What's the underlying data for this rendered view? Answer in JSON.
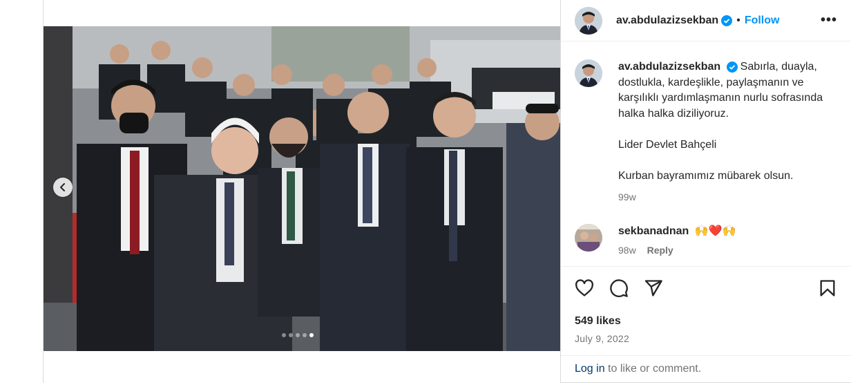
{
  "post": {
    "username": "av.abdulazizsekban",
    "verified_icon": "verified-badge-icon",
    "separator": "•",
    "follow_label": "Follow",
    "more_label": "•••",
    "caption": "Sabırla, duayla, dostlukla, kardeşlikle, paylaşmanın ve karşılıklı yardımlaşmanın nurlu sofrasında halka halka diziliyoruz.\n\nLider Devlet Bahçeli\n\nKurban bayramımız mübarek olsun.",
    "caption_time": "99w"
  },
  "comment": {
    "username": "sekbanadnan",
    "text": "🙌❤️🙌",
    "time": "98w",
    "reply_label": "Reply"
  },
  "actions": {
    "like_icon": "heart-icon",
    "comment_icon": "comment-icon",
    "share_icon": "share-icon",
    "save_icon": "bookmark-icon"
  },
  "likes": "549 likes",
  "date": "July 9, 2022",
  "login": {
    "link_label": "Log in",
    "rest": " to like or comment."
  },
  "carousel": {
    "slide_count": 5,
    "active_slide": 5
  },
  "colors": {
    "accent": "#0095f6",
    "link_dark": "#00376b",
    "muted": "#737373"
  }
}
